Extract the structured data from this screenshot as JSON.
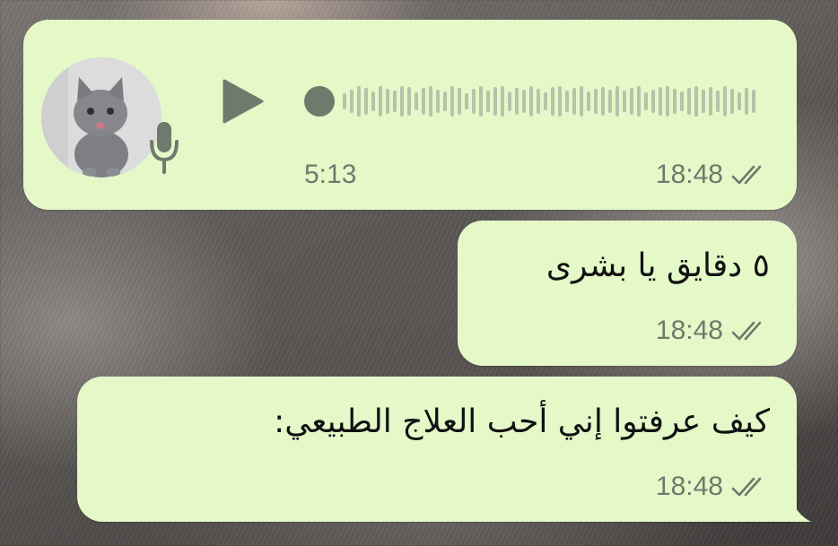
{
  "voice_message": {
    "duration": "5:13",
    "time": "18:48",
    "avatar_icon": "kitten-avatar",
    "status_icon": "double-check-icon"
  },
  "messages": [
    {
      "text": "٥ دقايق يا بشرى",
      "time": "18:48"
    },
    {
      "text": "كيف عرفتوا إني أحب العلاج الطبيعي:",
      "time": "18:48"
    }
  ],
  "colors": {
    "bubble": "#e4f8c8",
    "meta_text": "#6f7a6c",
    "control": "#6f7a6c",
    "wave": "#b5c3ab"
  }
}
